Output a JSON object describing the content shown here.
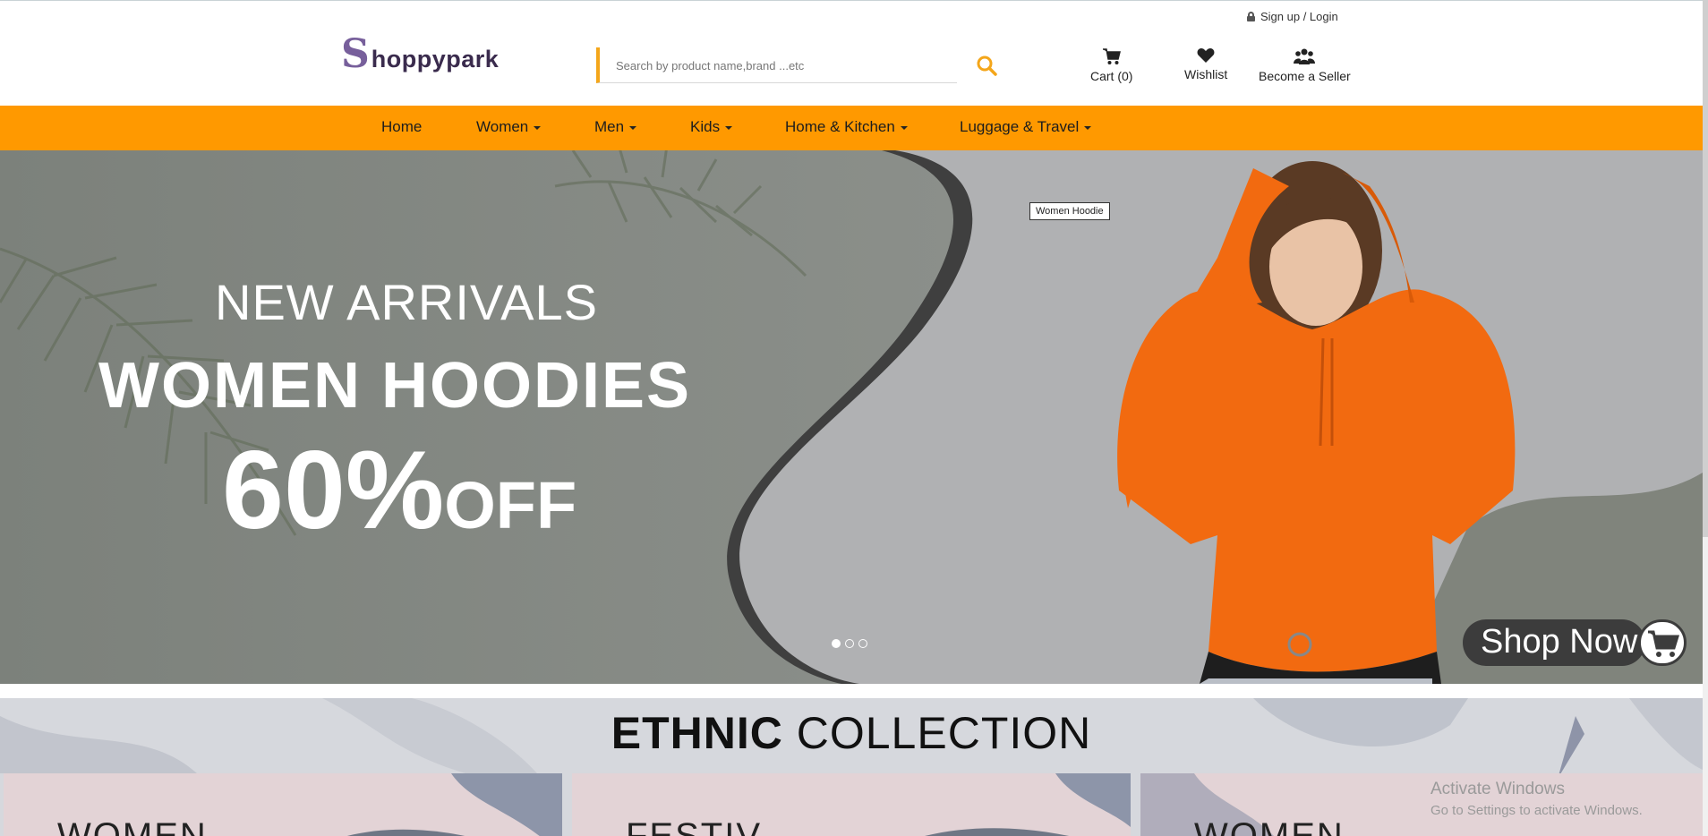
{
  "header": {
    "signup_label": "Sign up / Login",
    "logo": {
      "first_letter": "S",
      "rest": "hoppypark"
    },
    "search_placeholder": "Search by product name,brand ...etc",
    "cart_label": "Cart (0)",
    "wishlist_label": "Wishlist",
    "seller_label": "Become a Seller"
  },
  "nav": {
    "items": [
      {
        "label": "Home",
        "dropdown": false
      },
      {
        "label": "Women",
        "dropdown": true
      },
      {
        "label": "Men",
        "dropdown": true
      },
      {
        "label": "Kids",
        "dropdown": true
      },
      {
        "label": "Home & Kitchen",
        "dropdown": true
      },
      {
        "label": "Luggage & Travel",
        "dropdown": true
      }
    ]
  },
  "hero": {
    "line1": "NEW ARRIVALS",
    "line2": "WOMEN HOODIES",
    "discount": "60%",
    "off": "OFF",
    "tooltip": "Women Hoodie",
    "shop_now": "Shop Now",
    "slide_count": 3,
    "active_slide": 1
  },
  "ethnic": {
    "title_bold": "ETHNIC",
    "title_rest": "COLLECTION",
    "cards": [
      "WOMEN",
      "FESTIV",
      "WOMEN"
    ]
  },
  "watermark": {
    "title": "Activate Windows",
    "subtitle": "Go to Settings to activate Windows."
  },
  "colors": {
    "accent": "#ff9900",
    "logo_orange": "#f4a61a",
    "hoodie": "#f26a10"
  },
  "icons": [
    "lock-icon",
    "search-icon",
    "cart-icon",
    "heart-icon",
    "users-icon",
    "shopping-cart-icon"
  ]
}
